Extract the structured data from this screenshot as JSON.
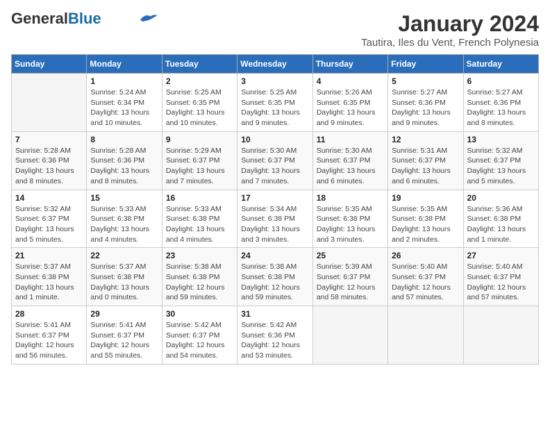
{
  "header": {
    "logo_general": "General",
    "logo_blue": "Blue",
    "title": "January 2024",
    "subtitle": "Tautira, Iles du Vent, French Polynesia"
  },
  "days_of_week": [
    "Sunday",
    "Monday",
    "Tuesday",
    "Wednesday",
    "Thursday",
    "Friday",
    "Saturday"
  ],
  "weeks": [
    [
      {
        "day": "",
        "info": ""
      },
      {
        "day": "1",
        "info": "Sunrise: 5:24 AM\nSunset: 6:34 PM\nDaylight: 13 hours\nand 10 minutes."
      },
      {
        "day": "2",
        "info": "Sunrise: 5:25 AM\nSunset: 6:35 PM\nDaylight: 13 hours\nand 10 minutes."
      },
      {
        "day": "3",
        "info": "Sunrise: 5:25 AM\nSunset: 6:35 PM\nDaylight: 13 hours\nand 9 minutes."
      },
      {
        "day": "4",
        "info": "Sunrise: 5:26 AM\nSunset: 6:35 PM\nDaylight: 13 hours\nand 9 minutes."
      },
      {
        "day": "5",
        "info": "Sunrise: 5:27 AM\nSunset: 6:36 PM\nDaylight: 13 hours\nand 9 minutes."
      },
      {
        "day": "6",
        "info": "Sunrise: 5:27 AM\nSunset: 6:36 PM\nDaylight: 13 hours\nand 8 minutes."
      }
    ],
    [
      {
        "day": "7",
        "info": "Sunrise: 5:28 AM\nSunset: 6:36 PM\nDaylight: 13 hours\nand 8 minutes."
      },
      {
        "day": "8",
        "info": "Sunrise: 5:28 AM\nSunset: 6:36 PM\nDaylight: 13 hours\nand 8 minutes."
      },
      {
        "day": "9",
        "info": "Sunrise: 5:29 AM\nSunset: 6:37 PM\nDaylight: 13 hours\nand 7 minutes."
      },
      {
        "day": "10",
        "info": "Sunrise: 5:30 AM\nSunset: 6:37 PM\nDaylight: 13 hours\nand 7 minutes."
      },
      {
        "day": "11",
        "info": "Sunrise: 5:30 AM\nSunset: 6:37 PM\nDaylight: 13 hours\nand 6 minutes."
      },
      {
        "day": "12",
        "info": "Sunrise: 5:31 AM\nSunset: 6:37 PM\nDaylight: 13 hours\nand 6 minutes."
      },
      {
        "day": "13",
        "info": "Sunrise: 5:32 AM\nSunset: 6:37 PM\nDaylight: 13 hours\nand 5 minutes."
      }
    ],
    [
      {
        "day": "14",
        "info": "Sunrise: 5:32 AM\nSunset: 6:37 PM\nDaylight: 13 hours\nand 5 minutes."
      },
      {
        "day": "15",
        "info": "Sunrise: 5:33 AM\nSunset: 6:38 PM\nDaylight: 13 hours\nand 4 minutes."
      },
      {
        "day": "16",
        "info": "Sunrise: 5:33 AM\nSunset: 6:38 PM\nDaylight: 13 hours\nand 4 minutes."
      },
      {
        "day": "17",
        "info": "Sunrise: 5:34 AM\nSunset: 6:38 PM\nDaylight: 13 hours\nand 3 minutes."
      },
      {
        "day": "18",
        "info": "Sunrise: 5:35 AM\nSunset: 6:38 PM\nDaylight: 13 hours\nand 3 minutes."
      },
      {
        "day": "19",
        "info": "Sunrise: 5:35 AM\nSunset: 6:38 PM\nDaylight: 13 hours\nand 2 minutes."
      },
      {
        "day": "20",
        "info": "Sunrise: 5:36 AM\nSunset: 6:38 PM\nDaylight: 13 hours\nand 1 minute."
      }
    ],
    [
      {
        "day": "21",
        "info": "Sunrise: 5:37 AM\nSunset: 6:38 PM\nDaylight: 13 hours\nand 1 minute."
      },
      {
        "day": "22",
        "info": "Sunrise: 5:37 AM\nSunset: 6:38 PM\nDaylight: 13 hours\nand 0 minutes."
      },
      {
        "day": "23",
        "info": "Sunrise: 5:38 AM\nSunset: 6:38 PM\nDaylight: 12 hours\nand 59 minutes."
      },
      {
        "day": "24",
        "info": "Sunrise: 5:38 AM\nSunset: 6:38 PM\nDaylight: 12 hours\nand 59 minutes."
      },
      {
        "day": "25",
        "info": "Sunrise: 5:39 AM\nSunset: 6:37 PM\nDaylight: 12 hours\nand 58 minutes."
      },
      {
        "day": "26",
        "info": "Sunrise: 5:40 AM\nSunset: 6:37 PM\nDaylight: 12 hours\nand 57 minutes."
      },
      {
        "day": "27",
        "info": "Sunrise: 5:40 AM\nSunset: 6:37 PM\nDaylight: 12 hours\nand 57 minutes."
      }
    ],
    [
      {
        "day": "28",
        "info": "Sunrise: 5:41 AM\nSunset: 6:37 PM\nDaylight: 12 hours\nand 56 minutes."
      },
      {
        "day": "29",
        "info": "Sunrise: 5:41 AM\nSunset: 6:37 PM\nDaylight: 12 hours\nand 55 minutes."
      },
      {
        "day": "30",
        "info": "Sunrise: 5:42 AM\nSunset: 6:37 PM\nDaylight: 12 hours\nand 54 minutes."
      },
      {
        "day": "31",
        "info": "Sunrise: 5:42 AM\nSunset: 6:36 PM\nDaylight: 12 hours\nand 53 minutes."
      },
      {
        "day": "",
        "info": ""
      },
      {
        "day": "",
        "info": ""
      },
      {
        "day": "",
        "info": ""
      }
    ]
  ]
}
